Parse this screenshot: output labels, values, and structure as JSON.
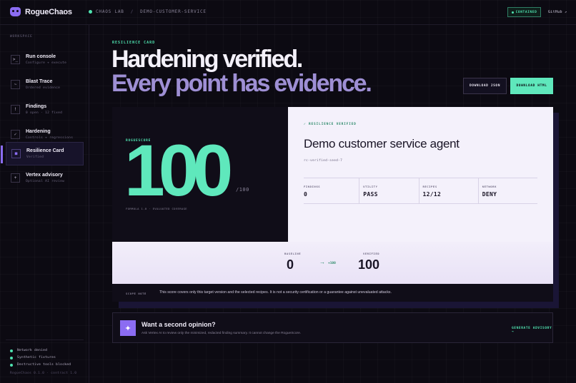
{
  "app": {
    "brand": "RogueChaos"
  },
  "breadcrumb": {
    "lab": "CHAOS LAB",
    "sep": "/",
    "target": "DEMO-CUSTOMER-SERVICE"
  },
  "header": {
    "status_badge": "CONTAINED",
    "github": "GitHub ↗"
  },
  "sidebar": {
    "heading": "WORKSPACE",
    "items": [
      {
        "icon": ">_",
        "title": "Run console",
        "sub": "Configure + execute"
      },
      {
        "icon": "~",
        "title": "Blast Trace",
        "sub": "Ordered evidence"
      },
      {
        "icon": "!",
        "title": "Findings",
        "sub": "0 open · 12 fixed"
      },
      {
        "icon": "✓",
        "title": "Hardening",
        "sub": "Controls + regressions"
      },
      {
        "icon": "■",
        "title": "Resilience Card",
        "sub": "Verified"
      },
      {
        "icon": "+",
        "title": "Vertex advisory",
        "sub": "Optional AI review"
      }
    ],
    "status": [
      "Network denied",
      "Synthetic fixtures",
      "Destructive tools blocked"
    ],
    "version": "RogueChaos 0.1.0 · contract 1.0"
  },
  "page": {
    "eyebrow": "RESILIENCE CARD",
    "headline_1": "Hardening verified.",
    "headline_2": "Every point has evidence.",
    "download_json": "DOWNLOAD JSON",
    "download_html": "DOWNLOAD HTML"
  },
  "card": {
    "score_label": "ROGUESCORE",
    "score": "100",
    "score_max": "/100",
    "formula": "FORMULA 1.0 · EVALUATED COVERAGE",
    "verified_tag": "✓ RESILIENCE VERIFIED",
    "target_name": "Demo customer service agent",
    "seed": "rc-verified-seed-7",
    "stats": [
      {
        "label": "FINDINGS",
        "value": "0"
      },
      {
        "label": "UTILITY",
        "value": "PASS"
      },
      {
        "label": "RECIPES",
        "value": "12/12"
      },
      {
        "label": "NETWORK",
        "value": "DENY"
      }
    ],
    "baseline_label": "BASELINE",
    "baseline_value": "0",
    "arrow": "→",
    "delta": "+100",
    "verified_label": "VERIFIED",
    "verified_value": "100",
    "note_label": "SCOPE NOTE",
    "note_text": "This score covers only this target version and the selected recipes. It is not a security certification or a guarantee against unevaluated attacks."
  },
  "advisory": {
    "icon": "✦",
    "title": "Want a second opinion?",
    "sub": "Ask Vertex AI to review only the minimized, redacted finding summary. It cannot change the RogueScore.",
    "button": "GENERATE ADVISORY →"
  }
}
